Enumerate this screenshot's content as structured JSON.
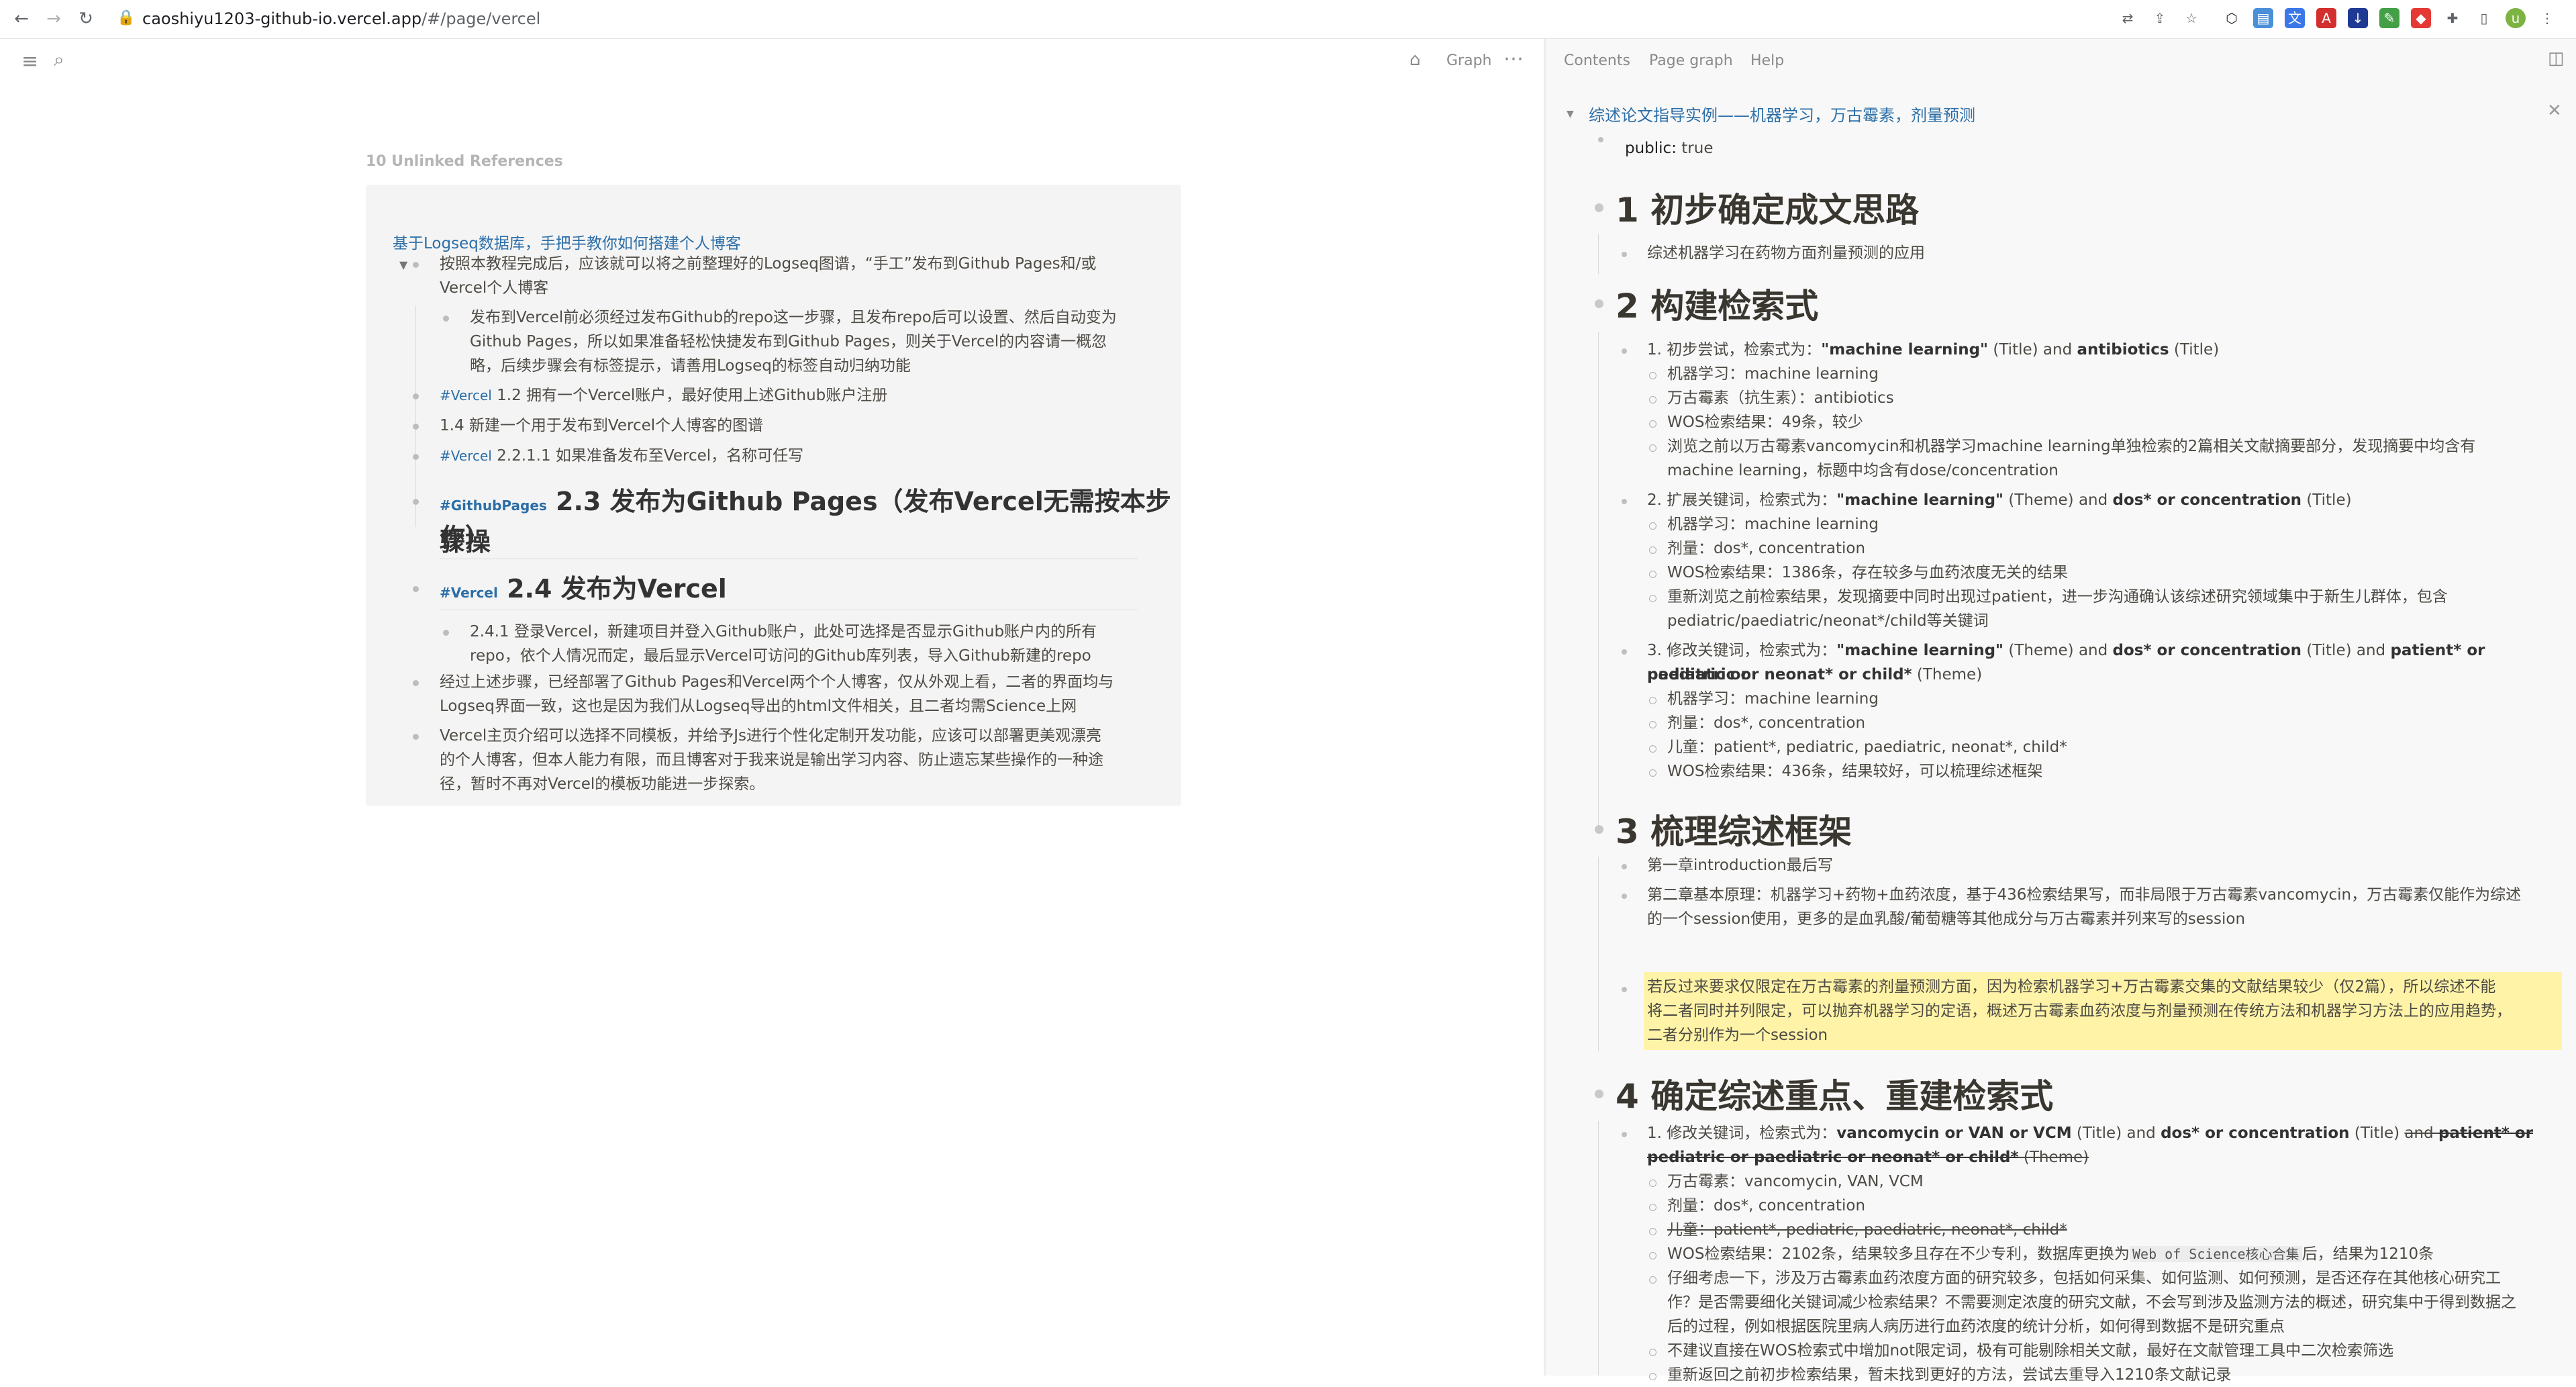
{
  "browser": {
    "url_host": "caoshiyu1203-github-io.vercel.app",
    "url_path": "/#/page/vercel",
    "back_icon": "arrow-left-icon",
    "forward_icon": "arrow-right-icon",
    "reload_icon": "reload-icon"
  },
  "toolbar": {
    "menu_icon": "menu-icon",
    "search_icon": "search-icon",
    "home_icon": "home-icon",
    "graph_label": "Graph",
    "more_icon": "more-icon"
  },
  "references": {
    "title": "10 Unlinked References",
    "page_link": "基于Logseq数据库，手把手教你如何搭建个人博客",
    "items": [
      "按照本教程完成后，应该就可以将之前整理好的Logseq图谱，“手工”发布到Github Pages和/或",
      "Vercel个人博客",
      "发布到Vercel前必须经过发布Github的repo这一步骤，且发布repo后可以设置、然后自动变为",
      "Github Pages，所以如果准备轻松快捷发布到Github Pages，则关于Vercel的内容请一概忽",
      "略，后续步骤会有标签提示，请善用Logseq的标签自动归纳功能",
      "1.2 拥有一个Vercel账户，最好使用上述Github账户注册",
      "1.4 新建一个用于发布到Vercel个人博客的图谱",
      "2.2.1.1 如果准备发布至Vercel，名称可任写",
      "2.3 发布为Github Pages（发布Vercel无需按本步骤操",
      "作）",
      "2.4 发布为Vercel",
      "2.4.1 登录Vercel，新建项目并登入Github账户，此处可选择是否显示Github账户内的所有",
      "repo，依个人情况而定，最后显示Vercel可访问的Github库列表，导入Github新建的repo",
      "经过上述步骤，已经部署了Github Pages和Vercel两个个人博客，仅从外观上看，二者的界面均与",
      "Logseq界面一致，这也是因为我们从Logseq导出的html文件相关，且二者均需Science上网",
      "Vercel主页介绍可以选择不同模板，并给予Js进行个性化定制开发功能，应该可以部署更美观漂亮",
      "的个人博客，但本人能力有限，而且博客对于我来说是输出学习内容、防止遗忘某些操作的一种途",
      "径，暂时不再对Vercel的模板功能进一步探索。"
    ],
    "tags": [
      "#Vercel",
      "#Vercel",
      "#GithubPages",
      "#Vercel"
    ]
  },
  "sidebar": {
    "tabs": [
      "Contents",
      "Page graph",
      "Help"
    ],
    "toggle_icon": "sidebar-toggle-icon",
    "close_icon": "close-icon",
    "page_title": "综述论文指导实例——机器学习，万古霉素，剂量预测",
    "prop_key": "public:",
    "prop_val": " true",
    "h1": "1 初步确定成文思路",
    "h1_items": [
      "综述机器学习在药物方面剂量预测的应用"
    ],
    "h2": "2 构建检索式",
    "h2_lines": [
      "1. 初步尝试，检索式为：",
      "\"machine learning\"",
      " (Title) and ",
      "antibiotics",
      " (Title)",
      "机器学习：machine learning",
      "万古霉素（抗生素）：antibiotics",
      "WOS检索结果：49条，较少",
      "浏览之前以万古霉素vancomycin和机器学习machine learning单独检索的2篇相关文献摘要部分，发现摘要中均含有",
      "machine learning，标题中均含有dose/concentration",
      "2. 扩展关键词，检索式为：",
      "\"machine learning\"",
      " (Theme) and ",
      "dos* or concentration",
      " (Title)",
      "机器学习：machine learning",
      "剂量：dos*, concentration",
      "WOS检索结果：1386条，存在较多与血药浓度无关的结果",
      "重新浏览之前检索结果，发现摘要中同时出现过patient，进一步沟通确认该综述研究领域集中于新生儿群体，包含",
      "pediatric/paediatric/neonat*/child等关键词",
      "3. 修改关键词，检索式为：",
      "\"machine learning\"",
      " (Theme) and ",
      "dos* or concentration",
      " (Title) and ",
      "patient* or pediatric or",
      "paediatric or neonat* or child*",
      " (Theme)",
      "机器学习：machine learning",
      "剂量：dos*, concentration",
      "儿童：patient*, pediatric, paediatric, neonat*, child*",
      "WOS检索结果：436条，结果较好，可以梳理综述框架"
    ],
    "h3": "3 梳理综述框架",
    "h3_items": [
      "第一章introduction最后写",
      "第二章基本原理：机器学习+药物+血药浓度，基于436检索结果写，而非局限于万古霉素vancomycin，万古霉素仅能作为综述",
      "的一个session使用，更多的是血乳酸/葡萄糖等其他成分与万古霉素并列来写的session",
      "若反过来要求仅限定在万古霉素的剂量预测方面，因为检索机器学习+万古霉素交集的文献结果较少（仅2篇），所以综述不能",
      "将二者同时并列限定，可以抛弃机器学习的定语，概述万古霉素血药浓度与剂量预测在传统方法和机器学习方法上的应用趋势，",
      "二者分别作为一个session"
    ],
    "h4": "4 确定综述重点、重建检索式",
    "h4_lines": [
      "1. 修改关键词，检索式为：",
      "vancomycin or VAN or VCM",
      " (Title) and ",
      "dos* or concentration",
      " (Title) ",
      "and ",
      "patient* or",
      "pediatric or paediatric or neonat* or child*",
      " (Theme)",
      "万古霉素：vancomycin, VAN, VCM",
      "剂量：dos*, concentration",
      "儿童：patient*, pediatric, paediatric, neonat*, child*",
      "WOS检索结果：2102条，结果较多且存在不少专利，数据库更换为",
      "Web of Science核心合集",
      "后，结果为1210条",
      "仔细考虑一下，涉及万古霉素血药浓度方面的研究较多，包括如何采集、如何监测、如何预测，是否还存在其他核心研究工",
      "作？是否需要细化关键词减少检索结果？不需要测定浓度的研究文献，不会写到涉及监测方法的概述，研究集中于得到数据之",
      "后的过程，例如根据医院里病人病历进行血药浓度的统计分析，如何得到数据不是研究重点",
      "不建议直接在WOS检索式中增加not限定词，极有可能剔除相关文献，最好在文献管理工具中二次检索筛选",
      "重新返回之前初步检索结果，暂未找到更好的方法，尝试去重导入1210条文献记录"
    ]
  }
}
